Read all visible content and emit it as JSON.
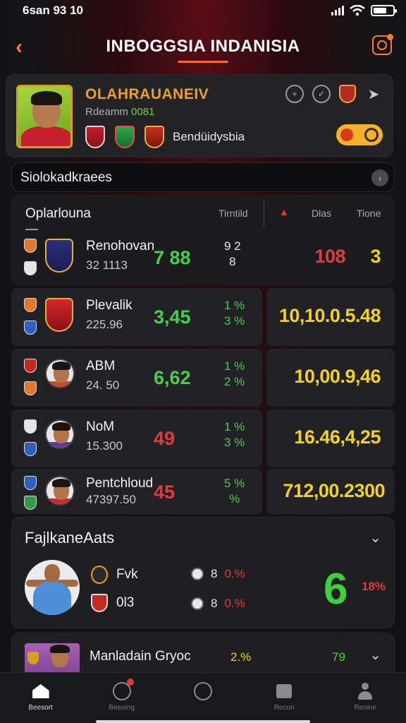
{
  "status": {
    "time": "6san 93 10"
  },
  "header": {
    "title": "INBOGGSIA INDANISIA"
  },
  "profile": {
    "name": "OLAHRAUANEIV",
    "sub_label": "Rdeamm",
    "sub_number": "0081",
    "club": "Bendüidysbia"
  },
  "section": {
    "title": "Siolokadkraees"
  },
  "table": {
    "header_label": "Oplarlouna",
    "col_total": "Tirntild",
    "col_odds": "Dlas",
    "col_time": "Tione"
  },
  "rows": [
    {
      "name": "Renohovan",
      "sub": "32 1113",
      "value": "7 88",
      "mini_top": "9 2",
      "mini_bottom": "8",
      "right": "108",
      "right_extra": "3"
    },
    {
      "name": "Plevalik",
      "sub": "225.96",
      "value": "3,45",
      "mini_top": "1 %",
      "mini_bottom": "3 %",
      "right": "10,10.0.5.48"
    },
    {
      "name": "ABM",
      "sub": "24. 50",
      "value": "6,62",
      "mini_top": "1 %",
      "mini_bottom": "2 %",
      "right": "10,00.9,46"
    },
    {
      "name": "NoM",
      "sub": "15.300",
      "value": "49",
      "mini_top": "1 %",
      "mini_bottom": "3 %",
      "right": "16.46,4,25"
    },
    {
      "name": "Pentchloud",
      "sub": "47397.50",
      "value": "45",
      "mini_top": "5 %",
      "mini_bottom": "%",
      "right": "712,00.2300"
    }
  ],
  "favorites": {
    "title": "FajlkaneAats",
    "items": [
      {
        "label": "Fvk",
        "stat_num": "8",
        "stat_pct": "0.%"
      },
      {
        "label": "0l3",
        "stat_num": "8",
        "stat_pct": "0.%"
      }
    ],
    "big_value": "6",
    "big_pct": "18%"
  },
  "bottom_card": {
    "title": "Manladain Gryoc",
    "v1": "2.%",
    "v2": "79"
  },
  "tabs": [
    {
      "label": "Beesort"
    },
    {
      "label": "Beeoing"
    },
    {
      "label": ""
    },
    {
      "label": "Recon"
    },
    {
      "label": "Reoine"
    }
  ],
  "colors": {
    "accent": "#ff7a2a",
    "positive": "#45d04a",
    "negative": "#e33a40",
    "highlight": "#f3d21a"
  }
}
